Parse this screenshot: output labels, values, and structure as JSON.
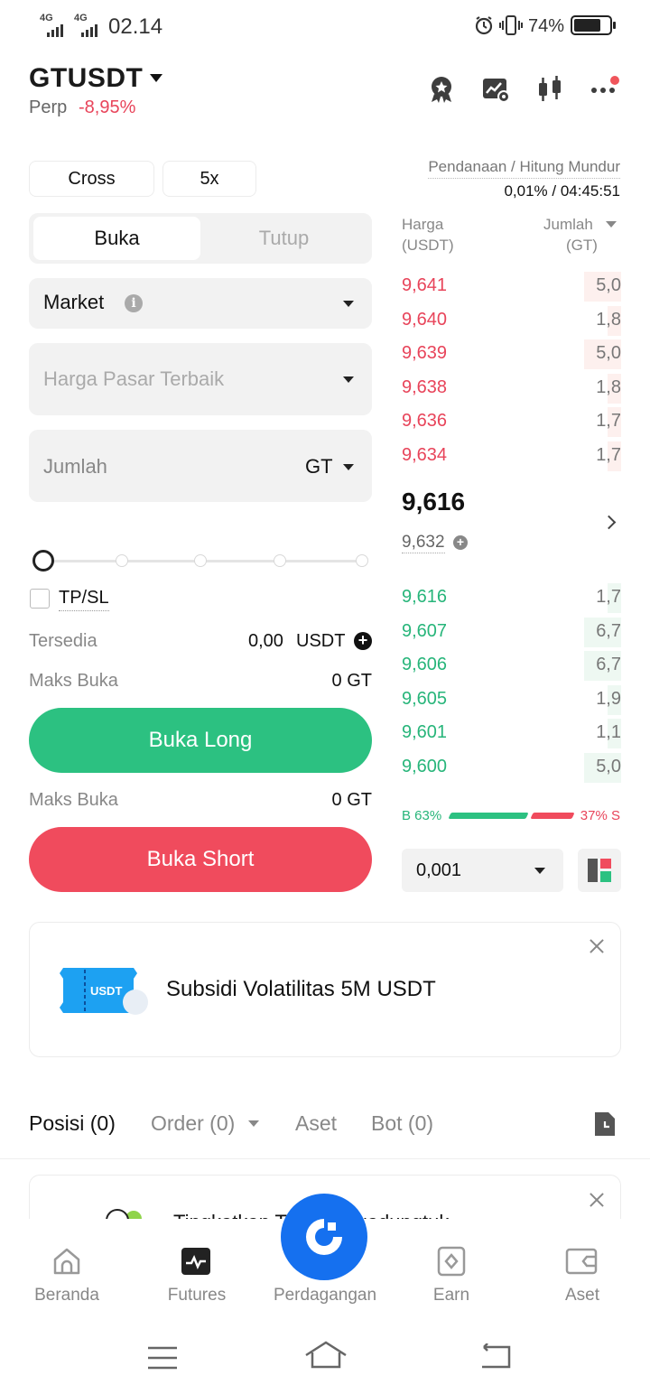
{
  "status_bar": {
    "network_1": "4G",
    "network_2": "4G",
    "time": "02.14",
    "battery": "74%"
  },
  "header": {
    "pair": "GTUSDT",
    "type": "Perp",
    "change": "-8,95%",
    "icons": [
      "award-icon",
      "chart-settings-icon",
      "candlestick-icon",
      "more-icon"
    ]
  },
  "form": {
    "margin_mode": "Cross",
    "leverage": "5x",
    "tabs": {
      "open": "Buka",
      "close": "Tutup"
    },
    "order_type": "Market",
    "price_placeholder": "Harga Pasar Terbaik",
    "amount_placeholder": "Jumlah",
    "amount_unit": "GT",
    "tpsl_label": "TP/SL",
    "available_label": "Tersedia",
    "available_value": "0,00",
    "available_unit": "USDT",
    "max_open_label": "Maks Buka",
    "max_open_long": "0 GT",
    "max_open_short": "0 GT",
    "long_button": "Buka Long",
    "short_button": "Buka Short"
  },
  "orderbook": {
    "funding_label": "Pendanaan / Hitung Mundur",
    "funding_value": "0,01% / 04:45:51",
    "price_header": "Harga",
    "price_unit": "(USDT)",
    "qty_header": "Jumlah",
    "qty_unit": "(GT)",
    "asks": [
      {
        "price": "9,641",
        "qty": "5,0",
        "depth": 0.17
      },
      {
        "price": "9,640",
        "qty": "1,8",
        "depth": 0.06
      },
      {
        "price": "9,639",
        "qty": "5,0",
        "depth": 0.17
      },
      {
        "price": "9,638",
        "qty": "1,8",
        "depth": 0.06
      },
      {
        "price": "9,636",
        "qty": "1,7",
        "depth": 0.06
      },
      {
        "price": "9,634",
        "qty": "1,7",
        "depth": 0.06
      }
    ],
    "last_price": "9,616",
    "mark_price": "9,632",
    "bids": [
      {
        "price": "9,616",
        "qty": "1,7",
        "depth": 0.06
      },
      {
        "price": "9,607",
        "qty": "6,7",
        "depth": 0.17
      },
      {
        "price": "9,606",
        "qty": "6,7",
        "depth": 0.17
      },
      {
        "price": "9,605",
        "qty": "1,9",
        "depth": 0.06
      },
      {
        "price": "9,601",
        "qty": "1,1",
        "depth": 0.06
      },
      {
        "price": "9,600",
        "qty": "5,0",
        "depth": 0.17
      }
    ],
    "buy_ratio": "B 63%",
    "sell_ratio": "37% S",
    "precision": "0,001"
  },
  "promo": {
    "ticket_label": "USDT",
    "text": "Subsidi Volatilitas 5M USDT"
  },
  "tabs": {
    "positions": "Posisi (0)",
    "orders": "Order (0)",
    "assets": "Aset",
    "bots": "Bot (0)"
  },
  "card2": {
    "text": "Tingkatkan Terus Tergadungtuk"
  },
  "bottom_nav": {
    "home": "Beranda",
    "futures": "Futures",
    "trade": "Perdagangan",
    "earn": "Earn",
    "assets": "Aset"
  },
  "colors": {
    "green": "#2cc181",
    "red": "#f04b5d",
    "brand_blue": "#1570ef"
  }
}
